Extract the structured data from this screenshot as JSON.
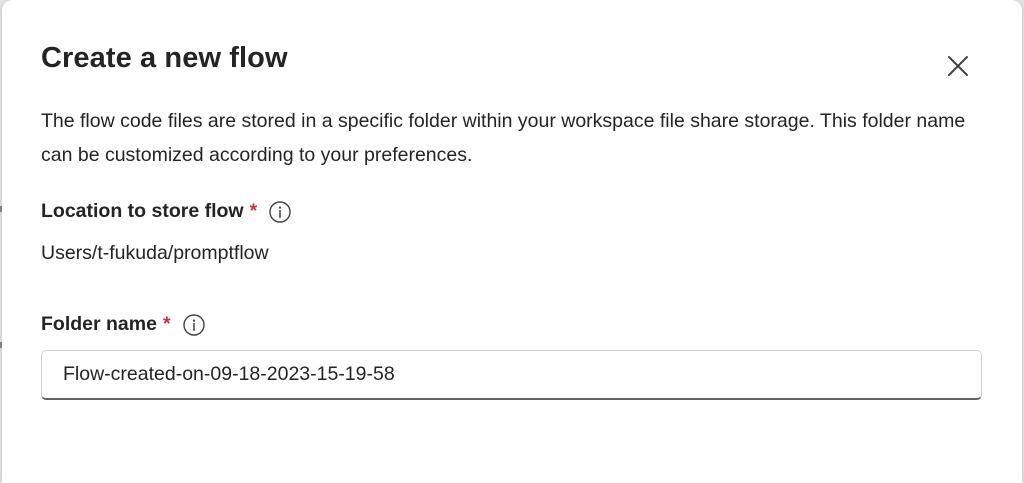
{
  "dialog": {
    "title": "Create a new flow",
    "close_icon": "close-icon",
    "description": "The flow code files are stored in a specific folder within your workspace file share storage. This folder name can be customized according to your preferences."
  },
  "location": {
    "label": "Location to store flow",
    "required_marker": "*",
    "info_icon": "info-icon",
    "value": "Users/t-fukuda/promptflow"
  },
  "folder": {
    "label": "Folder name",
    "required_marker": "*",
    "info_icon": "info-icon",
    "value": "Flow-created-on-09-18-2023-15-19-58"
  },
  "colors": {
    "required": "#c4314b",
    "text": "#242424",
    "input_border": "#d1d1d1",
    "input_underline": "#616161"
  }
}
